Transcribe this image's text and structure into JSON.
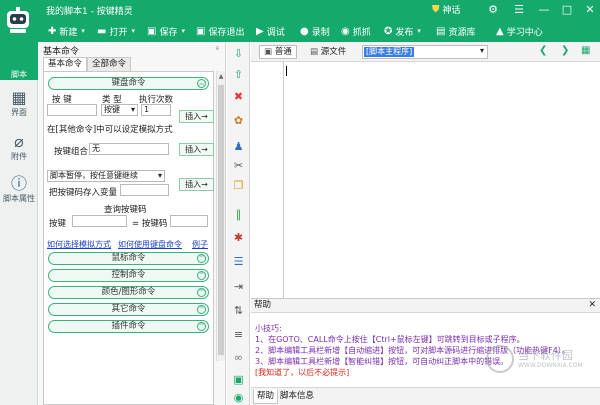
{
  "window": {
    "title": "我的脚本1 - 按键精灵",
    "vip_label": "神话",
    "controls": [
      "⚙",
      "☰",
      "—",
      "□",
      "✕"
    ]
  },
  "toolbar": {
    "new": "新建",
    "open": "打开",
    "save": "保存",
    "save_exit": "保存退出",
    "debug": "调试",
    "record": "录制",
    "capture": "抓抓",
    "publish": "发布",
    "resources": "资源库",
    "learn": "学习中心"
  },
  "sidebar": {
    "items": [
      {
        "label": "脚本",
        "icon": "robot-icon"
      },
      {
        "label": "界面",
        "icon": "grid-icon"
      },
      {
        "label": "附件",
        "icon": "paperclip-icon"
      },
      {
        "label": "脚本属性",
        "icon": "info-icon"
      }
    ]
  },
  "panel": {
    "title": "基本命令",
    "pin": "ᛜ",
    "tabs": [
      "基本命令",
      "全部命令"
    ],
    "key_section": {
      "title": "键盘命令",
      "col_key": "按 键",
      "col_type": "类 型",
      "col_count": "执行次数",
      "type_value": "按键",
      "count_value": "1",
      "insert": "插入→",
      "note": "在[其他命令]中可以设定模拟方式"
    },
    "combo": {
      "label": "按键组合",
      "value": "无",
      "insert": "插入→"
    },
    "pause": {
      "label": "脚本暂停，按任意键继续",
      "store_label": "把按键码存入变量",
      "insert": "插入→"
    },
    "query": {
      "title": "查询按键码",
      "key_label": "按键",
      "code_label": "= 按键码"
    },
    "links": [
      "如何选择模拟方式",
      "如何使用键盘命令",
      "例子"
    ],
    "sections": [
      "鼠标命令",
      "控制命令",
      "颜色/图形命令",
      "其它命令",
      "插件命令"
    ]
  },
  "editor": {
    "tab_normal": "普通",
    "tab_source": "源文件",
    "proc_selected": "[脚本主程序]"
  },
  "help": {
    "title": "帮助",
    "tip_title": "小技巧:",
    "lines": [
      "1、在GOTO、CALL命令上按住【Ctrl+鼠标左键】可跳转到目标或子程序。",
      "2、脚本编辑工具栏新增【自动缩进】按钮，可对脚本源码进行缩进排版（功能热键F4）。",
      "3、脚本编辑工具栏新增【智能纠错】按钮，可自动纠正脚本中的错误。"
    ],
    "dismiss": "[我知道了，以后不必提示]"
  },
  "bottom_tabs": [
    "帮助",
    "脚本信息"
  ],
  "watermark": {
    "title": "当下软件园",
    "sub": "WWW.DOWNXIA.COM"
  },
  "colors": {
    "brand": "#16a96c",
    "link": "#1c3fd1",
    "tip": "#7b2cb0",
    "alert": "#d8251c"
  }
}
